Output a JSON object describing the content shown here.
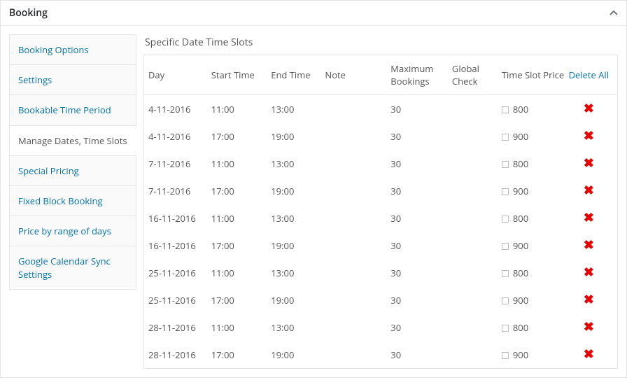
{
  "panel": {
    "title": "Booking"
  },
  "sidebar": {
    "items": [
      {
        "label": "Booking Options",
        "active": false
      },
      {
        "label": "Settings",
        "active": false
      },
      {
        "label": "Bookable Time Period",
        "active": false
      },
      {
        "label": "Manage Dates, Time Slots",
        "active": true
      },
      {
        "label": "Special Pricing",
        "active": false
      },
      {
        "label": "Fixed Block Booking",
        "active": false
      },
      {
        "label": "Price by range of days",
        "active": false
      },
      {
        "label": "Google Calendar Sync Settings",
        "active": false
      }
    ]
  },
  "section": {
    "title": "Specific Date Time Slots"
  },
  "table": {
    "headers": {
      "day": "Day",
      "start": "Start Time",
      "end": "End Time",
      "note": "Note",
      "max": "Maximum Bookings",
      "global": "Global Check",
      "price": "Time Slot Price",
      "deleteAll": "Delete All"
    },
    "rows": [
      {
        "day": "4-11-2016",
        "start": "11:00",
        "end": "13:00",
        "note": "",
        "max": "30",
        "global": "",
        "price": "800"
      },
      {
        "day": "4-11-2016",
        "start": "17:00",
        "end": "19:00",
        "note": "",
        "max": "30",
        "global": "",
        "price": "900"
      },
      {
        "day": "7-11-2016",
        "start": "11:00",
        "end": "13:00",
        "note": "",
        "max": "30",
        "global": "",
        "price": "800"
      },
      {
        "day": "7-11-2016",
        "start": "17:00",
        "end": "19:00",
        "note": "",
        "max": "30",
        "global": "",
        "price": "900"
      },
      {
        "day": "16-11-2016",
        "start": "11:00",
        "end": "13:00",
        "note": "",
        "max": "30",
        "global": "",
        "price": "800"
      },
      {
        "day": "16-11-2016",
        "start": "17:00",
        "end": "19:00",
        "note": "",
        "max": "30",
        "global": "",
        "price": "900"
      },
      {
        "day": "25-11-2016",
        "start": "11:00",
        "end": "13:00",
        "note": "",
        "max": "30",
        "global": "",
        "price": "800"
      },
      {
        "day": "25-11-2016",
        "start": "17:00",
        "end": "19:00",
        "note": "",
        "max": "30",
        "global": "",
        "price": "900"
      },
      {
        "day": "28-11-2016",
        "start": "11:00",
        "end": "13:00",
        "note": "",
        "max": "30",
        "global": "",
        "price": "800"
      },
      {
        "day": "28-11-2016",
        "start": "17:00",
        "end": "19:00",
        "note": "",
        "max": "30",
        "global": "",
        "price": "900"
      }
    ]
  }
}
